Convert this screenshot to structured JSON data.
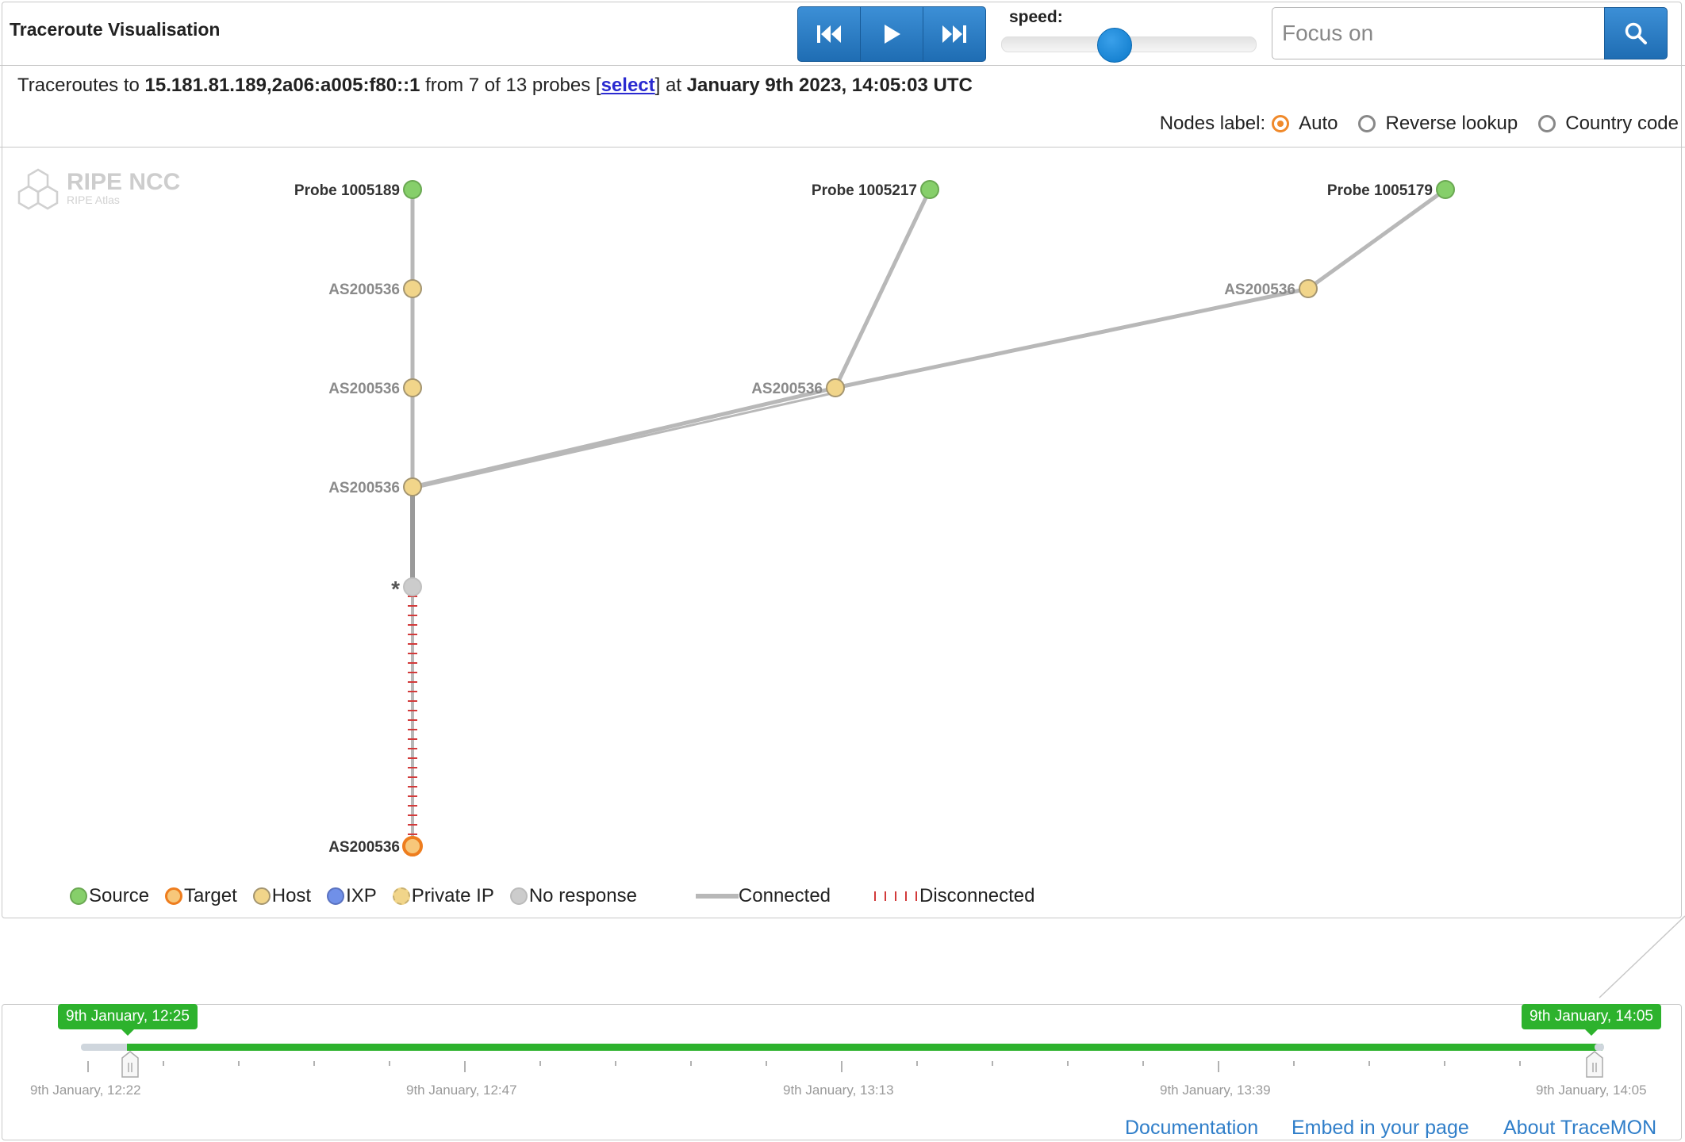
{
  "header": {
    "title": "Traceroute Visualisation",
    "speed_label": "speed:",
    "search_placeholder": "Focus on",
    "speed_value": 0.45
  },
  "info": {
    "prefix": "Traceroutes to",
    "target": "15.181.81.189,2a06:a005:f80::1",
    "middle": "from 7 of 13 probes [",
    "select_link": "select",
    "suffix": "] at",
    "timestamp": "January 9th 2023, 14:05:03 UTC"
  },
  "nodes_label": {
    "label": "Nodes label:",
    "options": [
      "Auto",
      "Reverse lookup",
      "Country code"
    ],
    "selected": "Auto"
  },
  "logo": {
    "name": "RIPE NCC",
    "sub": "RIPE Atlas"
  },
  "graph": {
    "nodes": {
      "p1": {
        "label": "Probe 1005189",
        "type": "source"
      },
      "p2": {
        "label": "Probe 1005217",
        "type": "source"
      },
      "p3": {
        "label": "Probe 1005179",
        "type": "source"
      },
      "a1": {
        "label": "AS200536",
        "type": "host"
      },
      "a2": {
        "label": "AS200536",
        "type": "host"
      },
      "a3": {
        "label": "AS200536",
        "type": "host"
      },
      "a4": {
        "label": "AS200536",
        "type": "host"
      },
      "a5": {
        "label": "AS200536",
        "type": "host"
      },
      "star": {
        "label": "*",
        "type": "noresponse"
      },
      "target": {
        "label": "AS200536",
        "type": "target"
      }
    },
    "edges": [
      {
        "from": "p1",
        "to": "a1",
        "kind": "connected"
      },
      {
        "from": "a1",
        "to": "a2",
        "kind": "connected"
      },
      {
        "from": "a2",
        "to": "a3",
        "kind": "connected"
      },
      {
        "from": "p2",
        "to": "a4",
        "kind": "connected"
      },
      {
        "from": "p3",
        "to": "a5",
        "kind": "connected"
      },
      {
        "from": "a5",
        "to": "a4",
        "kind": "connected"
      },
      {
        "from": "a4",
        "to": "a3",
        "kind": "connected"
      },
      {
        "from": "a3",
        "to": "star",
        "kind": "connected"
      },
      {
        "from": "star",
        "to": "target",
        "kind": "disconnected"
      }
    ]
  },
  "legend": {
    "source": "Source",
    "target": "Target",
    "host": "Host",
    "ixp": "IXP",
    "private": "Private IP",
    "noresponse": "No response",
    "connected": "Connected",
    "disconnected": "Disconnected"
  },
  "colors": {
    "source": "#86cf6a",
    "target": "#f7c77a",
    "target_border": "#ee7d1e",
    "host": "#f1d58a",
    "ixp": "#7090e8",
    "noresponse": "#cccccc",
    "edge": "#b8b8b8",
    "disconnected": "#d23a3a",
    "timeline_green": "#2db22d",
    "accent_blue": "#2a7ac8"
  },
  "timeline": {
    "start_badge": "9th January, 12:25",
    "end_badge": "9th January, 14:05",
    "tick_labels": [
      "9th January, 12:22",
      "9th January, 12:47",
      "9th January, 13:13",
      "9th January, 13:39",
      "9th January, 14:05"
    ]
  },
  "footer": {
    "documentation": "Documentation",
    "embed": "Embed in your page",
    "about": "About TraceMON"
  }
}
